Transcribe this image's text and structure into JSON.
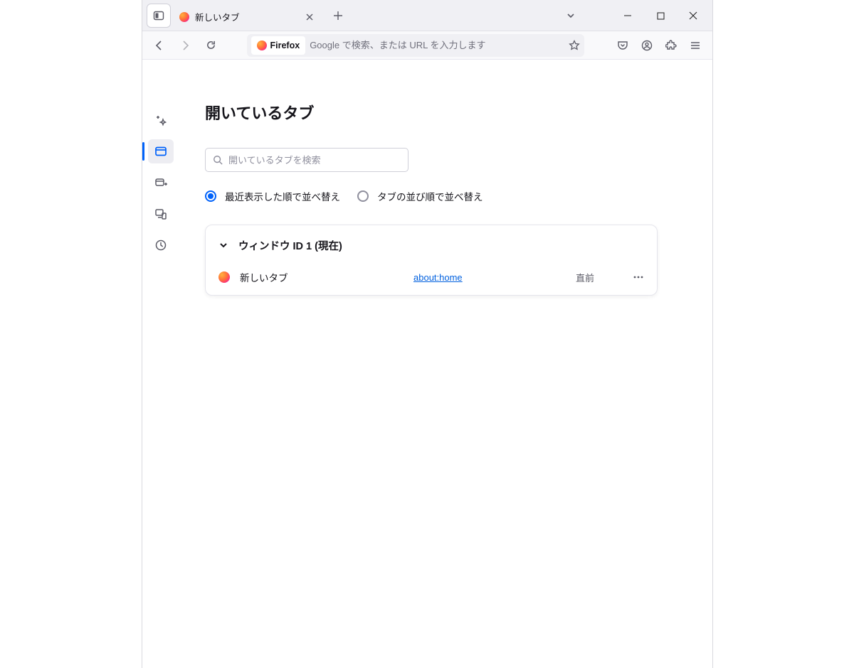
{
  "tab": {
    "title": "新しいタブ"
  },
  "urlbar": {
    "identity": "Firefox",
    "placeholder": "Google で検索、または URL を入力します"
  },
  "page": {
    "title": "開いているタブ",
    "search_placeholder": "開いているタブを検索",
    "sort_recent": "最近表示した順で並べ替え",
    "sort_tab_order": "タブの並び順で並べ替え"
  },
  "group": {
    "header": "ウィンドウ ID 1 (現在)"
  },
  "rows": [
    {
      "title": "新しいタブ",
      "url": "about:home",
      "time": "直前"
    }
  ]
}
